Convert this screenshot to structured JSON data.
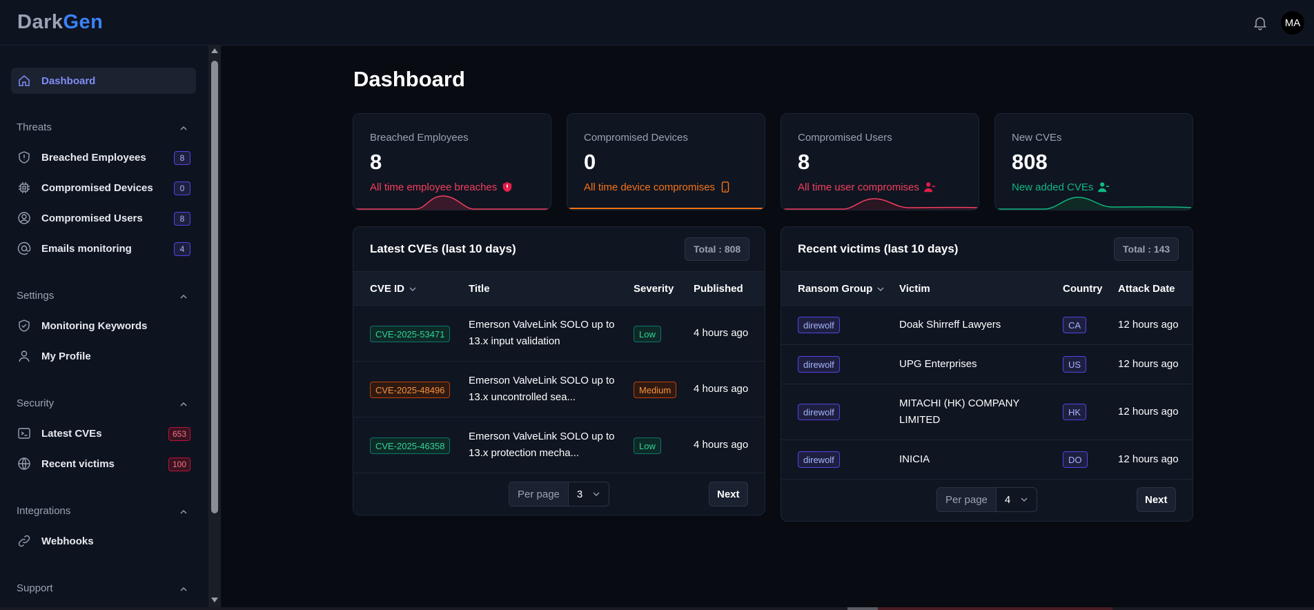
{
  "app": {
    "logo_dark": "Dark",
    "logo_gen": "Gen",
    "avatar_initials": "MA"
  },
  "sidebar": {
    "dashboard": "Dashboard",
    "sections": {
      "threats": "Threats",
      "settings": "Settings",
      "security": "Security",
      "integrations": "Integrations",
      "support": "Support"
    },
    "items": [
      {
        "label": "Breached Employees",
        "badge": "8",
        "icon": "shield-alert-icon"
      },
      {
        "label": "Compromised Devices",
        "badge": "0",
        "icon": "chip-icon"
      },
      {
        "label": "Compromised Users",
        "badge": "8",
        "icon": "user-circle-icon"
      },
      {
        "label": "Emails monitoring",
        "badge": "4",
        "icon": "at-sign-icon"
      },
      {
        "label": "Monitoring Keywords",
        "icon": "shield-check-icon"
      },
      {
        "label": "My Profile",
        "icon": "user-icon"
      },
      {
        "label": "Latest CVEs",
        "badge": "653",
        "icon": "terminal-icon"
      },
      {
        "label": "Recent victims",
        "badge": "100",
        "icon": "globe-icon"
      },
      {
        "label": "Webhooks",
        "icon": "link-icon"
      }
    ]
  },
  "main": {
    "title": "Dashboard",
    "stats": [
      {
        "label": "Breached Employees",
        "value": "8",
        "desc": "All time employee breaches",
        "color": "#f43f5e"
      },
      {
        "label": "Compromised Devices",
        "value": "0",
        "desc": "All time device compromises",
        "color": "#f97316"
      },
      {
        "label": "Compromised Users",
        "value": "8",
        "desc": "All time user compromises",
        "color": "#f43f5e"
      },
      {
        "label": "New CVEs",
        "value": "808",
        "desc": "New added CVEs",
        "color": "#10b981"
      }
    ],
    "cves": {
      "title": "Latest CVEs (last 10 days)",
      "total": "Total : 808",
      "columns": [
        "CVE ID",
        "Title",
        "Severity",
        "Published"
      ],
      "rows": [
        {
          "id": "CVE-2025-53471",
          "title1": "Emerson ValveLink SOLO up to",
          "title2": "13.x input validation",
          "severity": "Low",
          "published": "4 hours ago"
        },
        {
          "id": "CVE-2025-48496",
          "title1": "Emerson ValveLink SOLO up to",
          "title2": "13.x uncontrolled sea...",
          "severity": "Medium",
          "published": "4 hours ago"
        },
        {
          "id": "CVE-2025-46358",
          "title1": "Emerson ValveLink SOLO up to",
          "title2": "13.x protection mecha...",
          "severity": "Low",
          "published": "4 hours ago"
        }
      ],
      "per_page_label": "Per page",
      "per_page_value": "3",
      "next": "Next"
    },
    "victims": {
      "title": "Recent victims (last 10 days)",
      "total": "Total : 143",
      "columns": [
        "Ransom Group",
        "Victim",
        "Country",
        "Attack Date"
      ],
      "rows": [
        {
          "group": "direwolf",
          "victim1": "Doak Shirreff Lawyers",
          "victim2": "",
          "country": "CA",
          "date": "12 hours ago"
        },
        {
          "group": "direwolf",
          "victim1": "UPG Enterprises",
          "victim2": "",
          "country": "US",
          "date": "12 hours ago"
        },
        {
          "group": "direwolf",
          "victim1": "MITACHI (HK) COMPANY",
          "victim2": "LIMITED",
          "country": "HK",
          "date": "12 hours ago"
        },
        {
          "group": "direwolf",
          "victim1": "INICIA",
          "victim2": "",
          "country": "DO",
          "date": "12 hours ago"
        }
      ],
      "per_page_label": "Per page",
      "per_page_value": "4",
      "next": "Next"
    }
  }
}
